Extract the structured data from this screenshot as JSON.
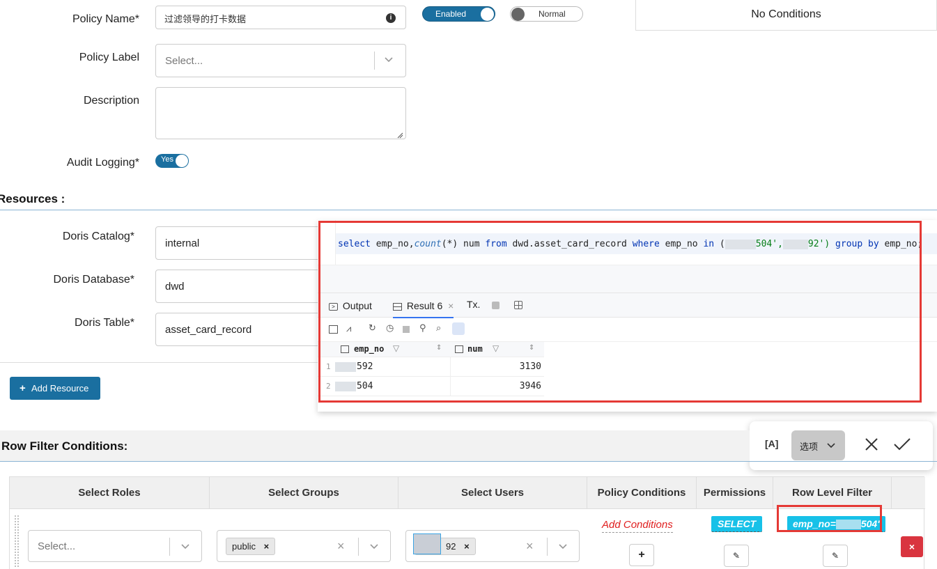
{
  "policy": {
    "name_label": "Policy Name*",
    "name_value": "过滤领导的打卡数据",
    "label_label": "Policy Label",
    "label_placeholder": "Select...",
    "description_label": "Description",
    "audit_label": "Audit Logging*",
    "audit_toggle": "Yes",
    "enabled_toggle": "Enabled",
    "normal_toggle": "Normal",
    "no_conditions": "No Conditions"
  },
  "resources": {
    "title": "Resources :",
    "catalog_label": "Doris Catalog*",
    "catalog_value": "internal",
    "database_label": "Doris Database*",
    "database_value": "dwd",
    "table_label": "Doris Table*",
    "table_value": "asset_card_record",
    "add_button": "Add Resource"
  },
  "sql_panel": {
    "query": {
      "kw_select": "select",
      "part1": " emp_no,",
      "fn_count": "count",
      "part2": "(*) num ",
      "kw_from": "from",
      "part3": " dwd.asset_card_record ",
      "kw_where": "where",
      "part4": " emp_no ",
      "kw_in": "in",
      "part5": " (",
      "val1": "504',",
      "val2": "92')",
      "kw_group": " group by",
      "part6": " emp_no;"
    },
    "tabs": {
      "output": "Output",
      "result": "Result 6",
      "tx": "Tx."
    },
    "columns": [
      "emp_no",
      "num"
    ],
    "rows": [
      {
        "index": "1",
        "emp_no": "592",
        "num": "3130"
      },
      {
        "index": "2",
        "emp_no": "504",
        "num": "3946"
      }
    ]
  },
  "screenshot_toolbar": {
    "options_label": "选项"
  },
  "row_filter": {
    "title": "Row Filter Conditions:",
    "headers": [
      "Select Roles",
      "Select Groups",
      "Select Users",
      "Policy Conditions",
      "Permissions",
      "Row Level Filter"
    ],
    "roles_placeholder": "Select...",
    "group_chip": "public",
    "user_chip": "92",
    "add_conditions": "Add Conditions",
    "permission": "SELECT",
    "filter_value": "emp_no=",
    "filter_suffix": "504'"
  },
  "colors": {
    "primary": "#1a6fa0",
    "cyan": "#17c1e8",
    "red_box": "#e53935",
    "danger": "#d9343f"
  }
}
